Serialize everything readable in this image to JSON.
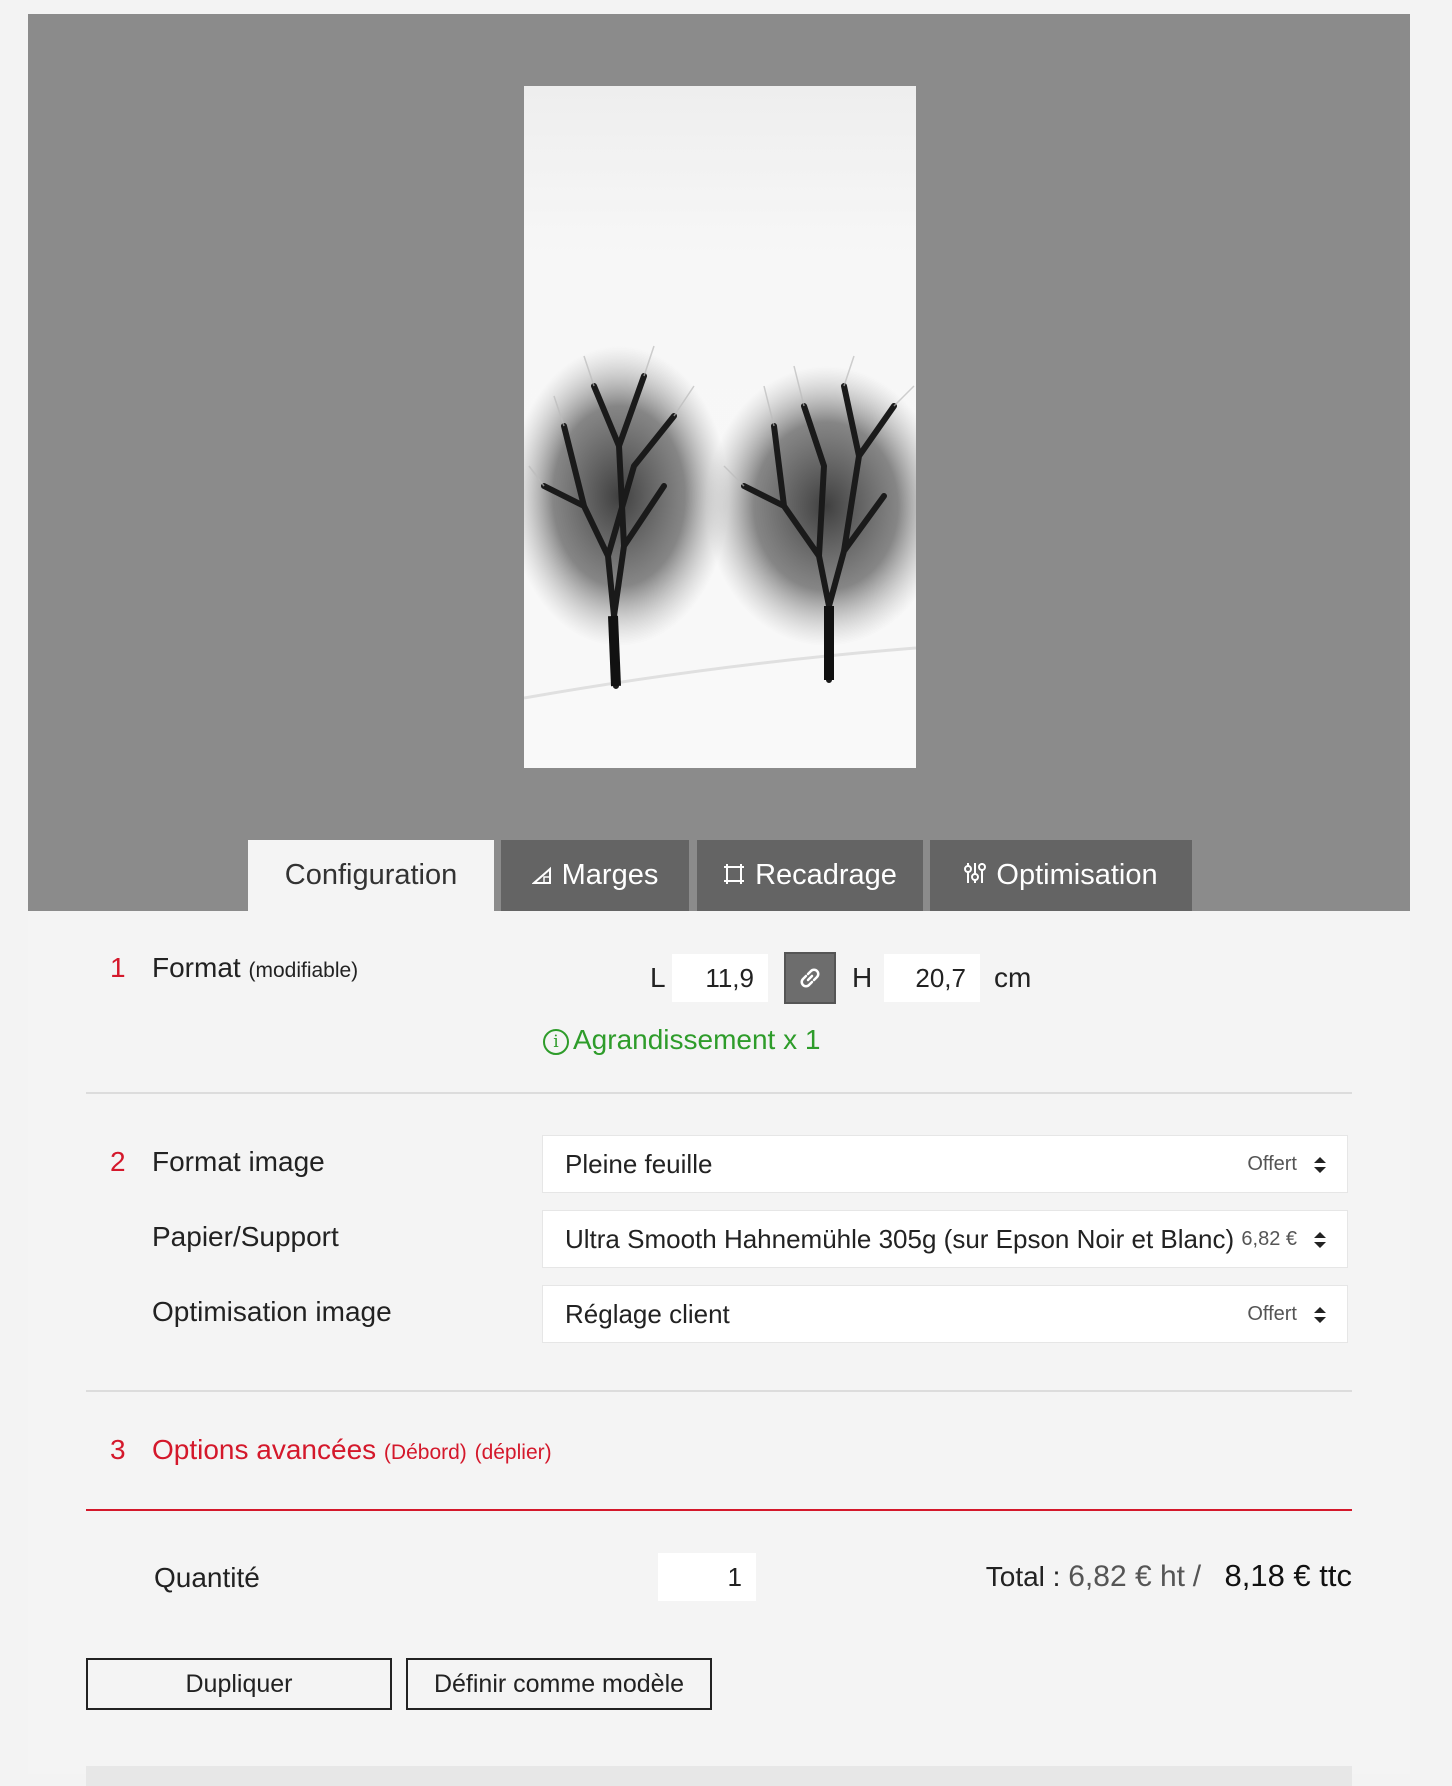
{
  "tabs": [
    {
      "label": "Configuration",
      "icon": ""
    },
    {
      "label": "Marges",
      "icon": "margin-icon"
    },
    {
      "label": "Recadrage",
      "icon": "crop-icon"
    },
    {
      "label": "Optimisation",
      "icon": "sliders-icon"
    }
  ],
  "format": {
    "number": "1",
    "label": "Format",
    "label_note": "(modifiable)",
    "width_label": "L",
    "width_value": "11,9",
    "height_label": "H",
    "height_value": "20,7",
    "unit": "cm",
    "info_icon": "i",
    "info_text": "Agrandissement x 1"
  },
  "options": {
    "number": "2",
    "rows": [
      {
        "label": "Format image",
        "value": "Pleine feuille",
        "price": "Offert"
      },
      {
        "label": "Papier/Support",
        "value": "Ultra Smooth Hahnemühle 305g (sur Epson Noir et Blanc)",
        "price": "6,82 €"
      },
      {
        "label": "Optimisation image",
        "value": "Réglage client",
        "price": "Offert"
      }
    ]
  },
  "advanced": {
    "number": "3",
    "label": "Options avancées",
    "bleed_link": "(Débord)",
    "expand_link": "(déplier)"
  },
  "quantity": {
    "label": "Quantité",
    "value": "1"
  },
  "total": {
    "label": "Total :",
    "ht": "6,82 € ht",
    "separator": "/",
    "ttc": "8,18 € ttc"
  },
  "buttons": {
    "duplicate": "Dupliquer",
    "template": "Définir comme modèle"
  },
  "colors": {
    "accent": "#d4182b",
    "success": "#2e9c2a",
    "preview_bg": "#8b8b8b",
    "tab_bg": "#646464"
  }
}
